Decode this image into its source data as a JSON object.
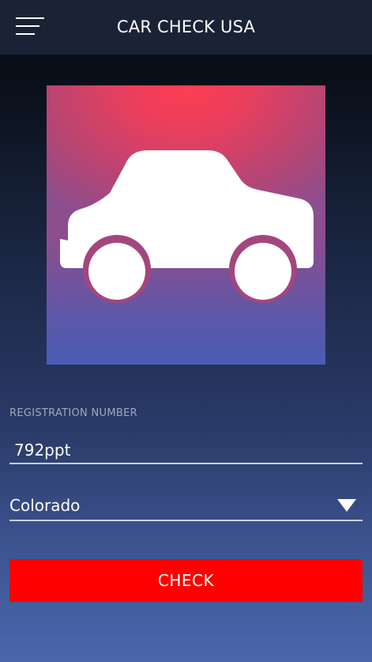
{
  "app": {
    "title": "CAR CHECK USA"
  },
  "header": {
    "menu_icon": "hamburger-menu-icon"
  },
  "hero": {
    "icon": "car-icon",
    "gradient_top": "#ff3d51",
    "gradient_bottom": "#4a5cb2"
  },
  "form": {
    "registration_label": "REGISTRATION NUMBER",
    "registration_value": "792ppt",
    "state_value": "Colorado",
    "check_label": "CHECK"
  },
  "colors": {
    "accent": "#ff0000",
    "appbar": "#1a2236"
  }
}
